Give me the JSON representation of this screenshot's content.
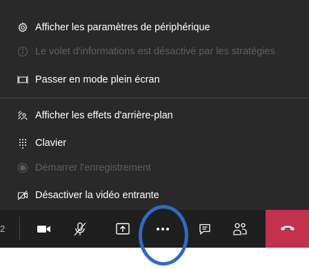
{
  "menu": {
    "items": [
      {
        "label": "Afficher les paramètres de périphérique",
        "icon": "gear-icon",
        "enabled": true
      },
      {
        "label": "Le volet d'informations est désactivé par les stratégies",
        "icon": "info-icon",
        "enabled": false
      },
      {
        "label": "Passer en mode plein écran",
        "icon": "fullscreen-icon",
        "enabled": true
      },
      {
        "label": "Afficher les effets d'arrière-plan",
        "icon": "background-effects-icon",
        "enabled": true
      },
      {
        "label": "Clavier",
        "icon": "dialpad-icon",
        "enabled": true
      },
      {
        "label": "Démarrer l'enregistrement",
        "icon": "record-icon",
        "enabled": false
      },
      {
        "label": "Désactiver la vidéo entrante",
        "icon": "video-off-icon",
        "enabled": true
      }
    ]
  },
  "toolbar": {
    "timer_fragment": "2",
    "buttons": [
      {
        "name": "camera",
        "icon": "camera-icon"
      },
      {
        "name": "mic",
        "icon": "mic-off-icon"
      },
      {
        "name": "share",
        "icon": "share-screen-icon"
      },
      {
        "name": "more",
        "icon": "more-icon"
      },
      {
        "name": "chat",
        "icon": "chat-icon"
      },
      {
        "name": "participants",
        "icon": "participants-icon"
      },
      {
        "name": "hangup",
        "icon": "hangup-icon"
      }
    ]
  },
  "colors": {
    "menu_bg": "#292929",
    "toolbar_bg": "#1f1f1f",
    "disabled_text": "#5e5e5e",
    "hangup": "#c4314b",
    "highlight": "#2f6bc4"
  }
}
